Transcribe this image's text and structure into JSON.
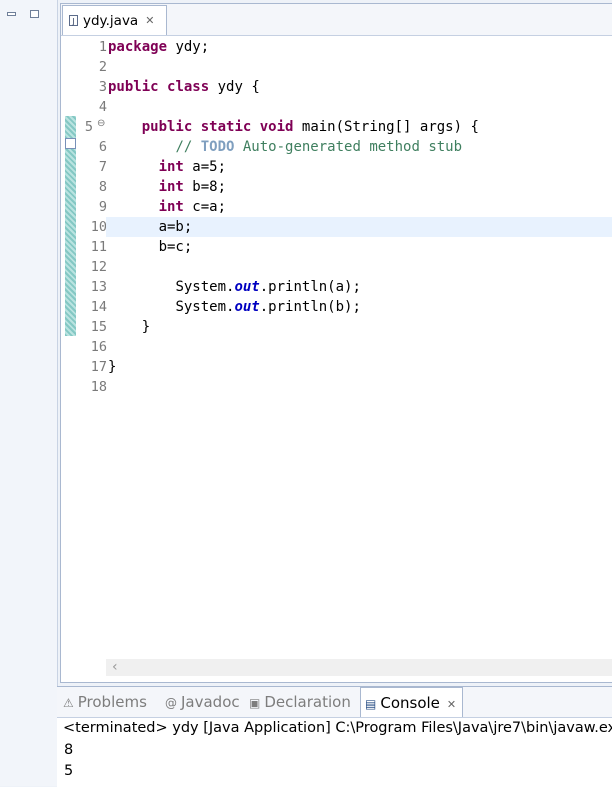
{
  "editor": {
    "tab_label": "ydy.java",
    "line_numbers": [
      "1",
      "2",
      "3",
      "4",
      "5",
      "6",
      "7",
      "8",
      "9",
      "10",
      "11",
      "12",
      "13",
      "14",
      "15",
      "16",
      "17",
      "18"
    ]
  },
  "code": {
    "l1_kw": "package",
    "l1_rest": " ydy;",
    "l3_kw1": "public",
    "l3_kw2": "class",
    "l3_rest": " ydy {",
    "l5_kw1": "public",
    "l5_kw2": "static",
    "l5_kw3": "void",
    "l5_rest": " main(String[] args) {",
    "l6_comment": "// ",
    "l6_todo": "TODO",
    "l6_rest": " Auto-generated method stub",
    "l7_kw": "int",
    "l7_rest": " a=5;",
    "l8_kw": "int",
    "l8_rest": " b=8;",
    "l9_kw": "int",
    "l9_rest": " c=a;",
    "l10": "a=b;",
    "l11": "b=c;",
    "l13_pre": "System.",
    "l13_field": "out",
    "l13_post": ".println(a);",
    "l14_pre": "System.",
    "l14_field": "out",
    "l14_post": ".println(b);",
    "l15": "}",
    "l17": "}"
  },
  "console": {
    "tabs": {
      "problems": "Problems",
      "javadoc": "Javadoc",
      "declaration": "Declaration",
      "console": "Console"
    },
    "status": "<terminated> ydy [Java Application] C:\\Program Files\\Java\\jre7\\bin\\javaw.ex",
    "output": [
      "8",
      "5"
    ]
  }
}
